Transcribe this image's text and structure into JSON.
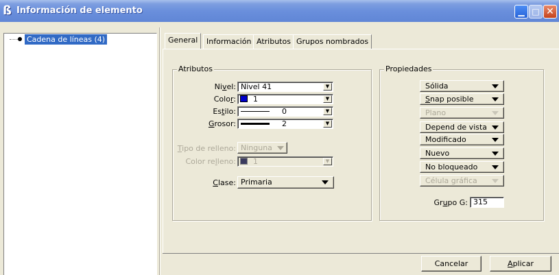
{
  "window": {
    "title": "Información de elemento",
    "icon": "app-icon",
    "controls": {
      "minimize": "minimize-icon",
      "maximize": "maximize-icon",
      "close": "close-icon"
    }
  },
  "tree": {
    "items": [
      {
        "label": "Cadena de líneas (4)",
        "selected": true
      }
    ]
  },
  "tabs": [
    {
      "label": "General",
      "active": true
    },
    {
      "label": "Información",
      "active": false
    },
    {
      "label": "Atributos",
      "active": false
    },
    {
      "label": "Grupos nombrados",
      "active": false
    }
  ],
  "atributos": {
    "title": "Atributos",
    "nivel": {
      "label_pre": "Ni",
      "label_u": "v",
      "label_post": "el:",
      "value": "Nivel 41"
    },
    "color": {
      "label_pre": "Colo",
      "label_u": "r",
      "label_post": ":",
      "value": "1",
      "swatch": "#0000cc"
    },
    "estilo": {
      "label_pre": "Es",
      "label_u": "t",
      "label_post": "ilo:",
      "value": "0"
    },
    "grosor": {
      "label_pre": "",
      "label_u": "G",
      "label_post": "rosor:",
      "value": "2"
    },
    "tipo_relleno": {
      "label_pre": "",
      "label_u": "T",
      "label_post": "ipo de relleno:",
      "value": "Ninguna"
    },
    "color_relleno": {
      "label_pre": "Color re",
      "label_u": "l",
      "label_post": "leno:",
      "value": "1"
    },
    "clase": {
      "label_pre": "",
      "label_u": "C",
      "label_post": "lase:",
      "value": "Primaria"
    }
  },
  "propiedades": {
    "title": "Propiedades",
    "items": [
      {
        "label": "Sólida",
        "u": "",
        "enabled": true
      },
      {
        "label": "Snap posible",
        "u": "S",
        "enabled": true
      },
      {
        "label": "Plano",
        "u": "",
        "enabled": false
      },
      {
        "label": "Depend de vista",
        "u": "",
        "enabled": true
      },
      {
        "label": "Modificado",
        "u": "",
        "enabled": true
      },
      {
        "label": "Nuevo",
        "u": "",
        "enabled": true
      },
      {
        "label": "No bloqueado",
        "u": "",
        "enabled": true
      },
      {
        "label": "Célula gráfica",
        "u": "",
        "enabled": false
      }
    ],
    "grupo_g": {
      "label_pre": "Gr",
      "label_u": "u",
      "label_post": "po G:",
      "value": "315"
    }
  },
  "buttons": {
    "cancel": "Cancelar",
    "apply_u": "A",
    "apply_rest": "plicar"
  }
}
